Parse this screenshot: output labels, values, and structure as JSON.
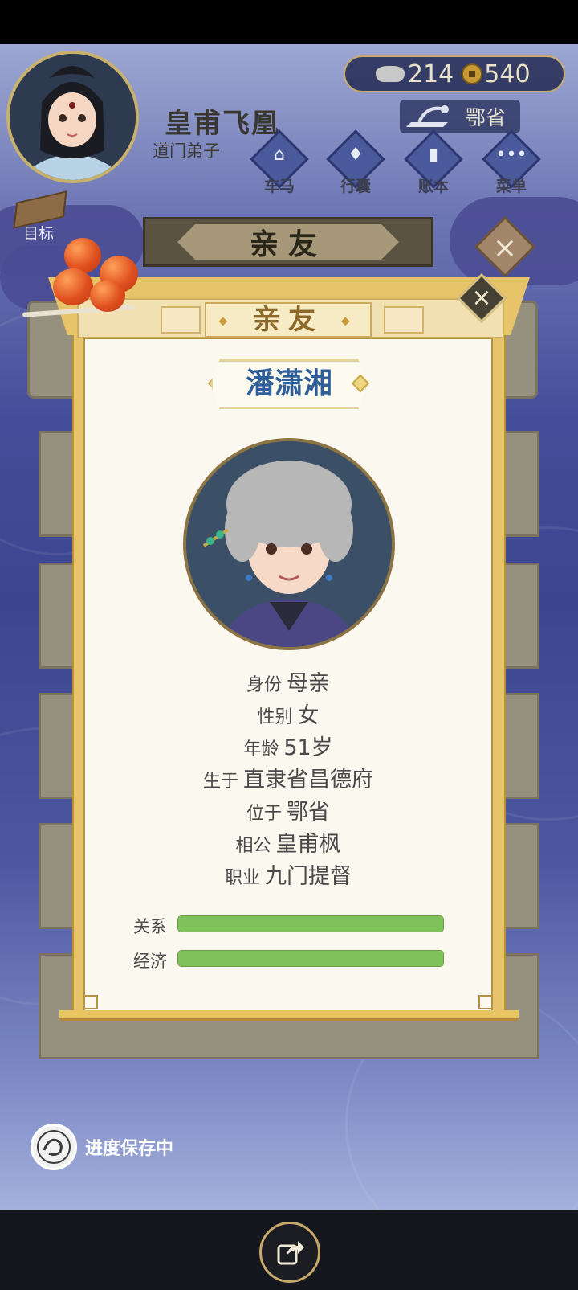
{
  "player": {
    "name": "皇甫飞凰",
    "title": "道门弟子"
  },
  "currency": {
    "silver": "214",
    "coins": "540"
  },
  "location": "鄂省",
  "nav": [
    {
      "label": "车马",
      "icon": "carriage-icon"
    },
    {
      "label": "行囊",
      "icon": "bundle-icon"
    },
    {
      "label": "账本",
      "icon": "ledger-icon"
    },
    {
      "label": "菜单",
      "icon": "menu-dots-icon"
    }
  ],
  "goal_label": "目标",
  "background_panel_title": "亲友",
  "modal": {
    "title": "亲友",
    "person_name": "潘潇湘",
    "fields": [
      {
        "key": "身份",
        "value": "母亲"
      },
      {
        "key": "性别",
        "value": "女"
      },
      {
        "key": "年龄",
        "value": "51岁"
      },
      {
        "key": "生于",
        "value": "直隶省昌德府"
      },
      {
        "key": "位于",
        "value": "鄂省"
      },
      {
        "key": "相公",
        "value": "皇甫枫"
      },
      {
        "key": "职业",
        "value": "九门提督"
      }
    ],
    "bars": [
      {
        "label": "关系",
        "value": 1.0,
        "color": "#80c25a"
      },
      {
        "label": "经济",
        "value": 1.0,
        "color": "#80c25a"
      }
    ]
  },
  "status": {
    "saving_text": "进度保存中"
  },
  "colors": {
    "accent_gold": "#e7c36a",
    "name_blue": "#2f5e98",
    "bar_green": "#80c25a"
  }
}
